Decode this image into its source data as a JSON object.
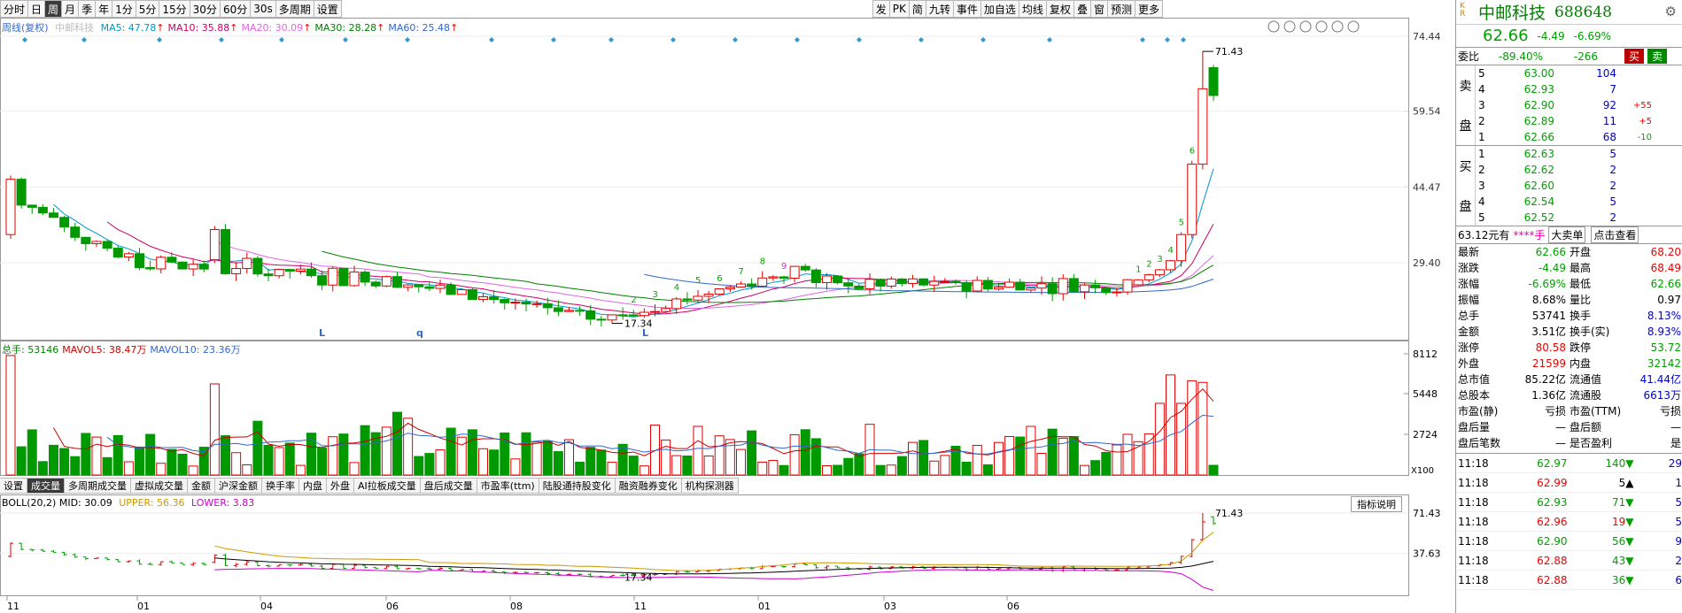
{
  "toolbar": {
    "left": [
      "分时",
      "日",
      "周",
      "月",
      "季",
      "年",
      "1分",
      "5分",
      "15分",
      "30分",
      "60分",
      "30s",
      "多周期",
      "设置"
    ],
    "active": "周",
    "right": [
      "发",
      "PK",
      "简",
      "九转",
      "事件",
      "加自选",
      "均线",
      "复权",
      "叠",
      "窗",
      "预测",
      "更多"
    ]
  },
  "kline": {
    "title": "周线(复权)",
    "stock": "中邮科技",
    "ma": [
      {
        "name": "MA5",
        "value": "47.78",
        "color": "#0099cc"
      },
      {
        "name": "MA10",
        "value": "35.88",
        "color": "#cc0066"
      },
      {
        "name": "MA20",
        "value": "30.09",
        "color": "#e066e0"
      },
      {
        "name": "MA30",
        "value": "28.28",
        "color": "#008000"
      },
      {
        "name": "MA60",
        "value": "25.48",
        "color": "#3366cc"
      }
    ],
    "yticks": [
      "74.44",
      "59.54",
      "44.47",
      "29.40"
    ],
    "high_label": "71.43",
    "low_label": "17.34",
    "markers": [
      "L",
      "q",
      "L"
    ],
    "seq_green": [
      "2",
      "3",
      "4",
      "5",
      "6",
      "7",
      "8"
    ],
    "seq_pink": "9",
    "seq_red": [
      "1",
      "2",
      "3",
      "4",
      "5",
      "6"
    ]
  },
  "volume": {
    "legend": [
      {
        "name": "总手",
        "value": "53146",
        "color": "#008000"
      },
      {
        "name": "MAVOL5",
        "value": "38.47万",
        "color": "#cc0000"
      },
      {
        "name": "MAVOL10",
        "value": "23.36万",
        "color": "#3366cc"
      }
    ],
    "yticks": [
      "8112",
      "5448",
      "2724"
    ],
    "unit": "X100"
  },
  "tabs": {
    "items": [
      "设置",
      "成交量",
      "多周期成交量",
      "虚拟成交量",
      "金额",
      "沪深金额",
      "换手率",
      "内盘",
      "外盘",
      "AI拉板成交量",
      "盘后成交量",
      "市盈率(ttm)",
      "陆股通持股变化",
      "融资融券变化",
      "机构探测器"
    ],
    "active": "成交量"
  },
  "boll": {
    "legend": "BOLL(20,2)  MID: 30.09",
    "upper": "UPPER: 56.36",
    "lower": "LOWER: 3.83",
    "yticks": [
      "71.43",
      "37.63"
    ],
    "high_label": "71.43",
    "low_label": "17.34",
    "explain": "指标说明"
  },
  "xaxis": [
    "11",
    "01",
    "04",
    "06",
    "08",
    "11",
    "01",
    "03",
    "06"
  ],
  "quote": {
    "name": "中邮科技",
    "code": "688648",
    "price": "62.66",
    "change": "-4.49",
    "pct": "-6.69%",
    "weibi_label": "委比",
    "weibi": "-89.40%",
    "weicha": "-266",
    "buy": "买",
    "sell": "卖",
    "sell_label": [
      "卖",
      "盘"
    ],
    "buy_label": [
      "买",
      "盘"
    ],
    "asks": [
      {
        "lv": "5",
        "p": "63.00",
        "v": "104",
        "d": ""
      },
      {
        "lv": "4",
        "p": "62.93",
        "v": "7",
        "d": ""
      },
      {
        "lv": "3",
        "p": "62.90",
        "v": "92",
        "d": "+55"
      },
      {
        "lv": "2",
        "p": "62.89",
        "v": "11",
        "d": "+5"
      },
      {
        "lv": "1",
        "p": "62.66",
        "v": "68",
        "d": "-10"
      }
    ],
    "bids": [
      {
        "lv": "1",
        "p": "62.63",
        "v": "5"
      },
      {
        "lv": "2",
        "p": "62.62",
        "v": "2"
      },
      {
        "lv": "3",
        "p": "62.60",
        "v": "2"
      },
      {
        "lv": "4",
        "p": "62.54",
        "v": "5"
      },
      {
        "lv": "5",
        "p": "62.52",
        "v": "2"
      }
    ],
    "banner": [
      "63.12元有",
      "****手",
      "大卖单",
      "点击查看"
    ],
    "stats": [
      [
        "最新",
        "62.66",
        "开盘",
        "68.20"
      ],
      [
        "涨跌",
        "-4.49",
        "最高",
        "68.49"
      ],
      [
        "涨幅",
        "-6.69%",
        "最低",
        "62.66"
      ],
      [
        "振幅",
        "8.68%",
        "量比",
        "0.97"
      ],
      [
        "总手",
        "53741",
        "换手",
        "8.13%"
      ],
      [
        "金额",
        "3.51亿",
        "换手(实)",
        "8.93%"
      ],
      [
        "涨停",
        "80.58",
        "跌停",
        "53.72"
      ],
      [
        "外盘",
        "21599",
        "内盘",
        "32142"
      ],
      [
        "总市值",
        "85.22亿",
        "流通值",
        "41.44亿"
      ],
      [
        "总股本",
        "1.36亿",
        "流通股",
        "6613万"
      ],
      [
        "市盈(静)",
        "亏损",
        "市盈(TTM)",
        "亏损"
      ],
      [
        "盘后量",
        "—",
        "盘后额",
        "—"
      ],
      [
        "盘后笔数",
        "—",
        "是否盈利",
        "是"
      ]
    ],
    "trades": [
      {
        "t": "11:18",
        "p": "62.97",
        "v": "140",
        "n": "29"
      },
      {
        "t": "11:18",
        "p": "62.99",
        "v": "5",
        "n": "1"
      },
      {
        "t": "11:18",
        "p": "62.93",
        "v": "71",
        "n": "5"
      },
      {
        "t": "11:18",
        "p": "62.96",
        "v": "19",
        "n": "5"
      },
      {
        "t": "11:18",
        "p": "62.90",
        "v": "56",
        "n": "9"
      },
      {
        "t": "11:18",
        "p": "62.88",
        "v": "43",
        "n": "2"
      },
      {
        "t": "11:18",
        "p": "62.88",
        "v": "36",
        "n": "6"
      }
    ]
  },
  "colors": {
    "up": "#e00000",
    "down": "#009900",
    "bg": "#ffffff"
  }
}
